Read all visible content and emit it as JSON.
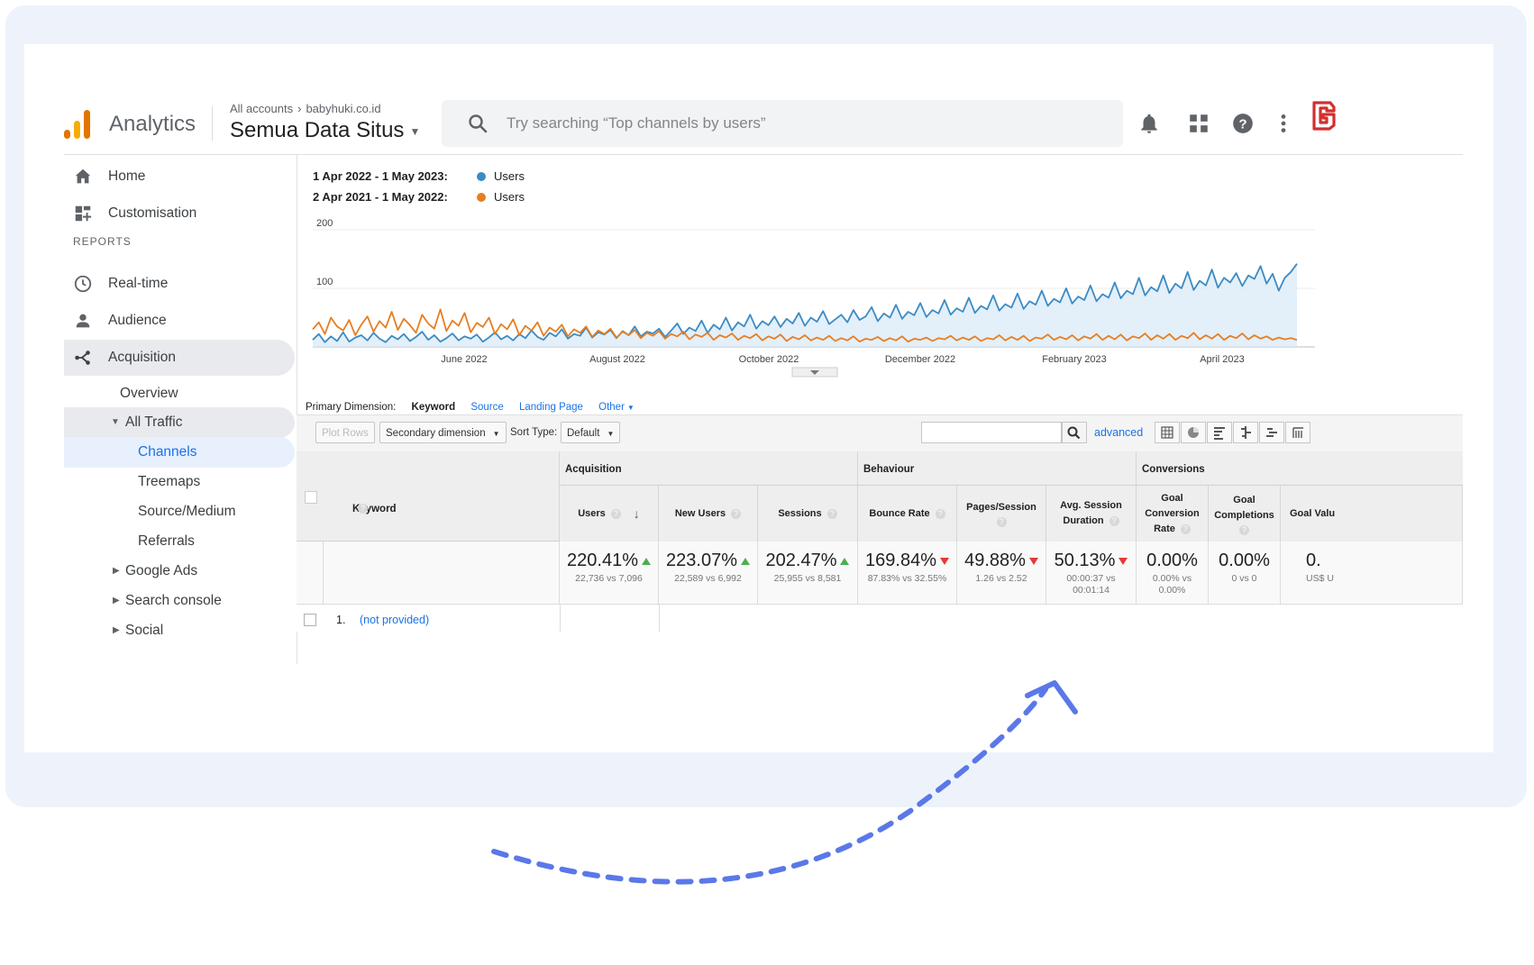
{
  "topbar": {
    "brand": "Analytics",
    "breadcrumb": [
      "All accounts",
      "babyhuki.co.id"
    ],
    "property": "Semua Data Situs",
    "search_placeholder": "Try searching “Top channels by users”"
  },
  "sidebar": {
    "items": [
      {
        "label": "Home",
        "icon": "home-icon"
      },
      {
        "label": "Customisation",
        "icon": "dashboard-icon"
      }
    ],
    "section": "REPORTS",
    "reports": [
      {
        "label": "Real-time",
        "icon": "clock-icon"
      },
      {
        "label": "Audience",
        "icon": "person-icon"
      },
      {
        "label": "Acquisition",
        "icon": "acquisition-icon"
      }
    ],
    "acquisition_sub": {
      "overview": "Overview",
      "all_traffic": "All Traffic",
      "channels": "Channels",
      "treemaps": "Treemaps",
      "source_medium": "Source/Medium",
      "referrals": "Referrals",
      "google_ads": "Google Ads",
      "search_console": "Search console",
      "social": "Social"
    }
  },
  "chart_data": {
    "type": "line",
    "legend": [
      {
        "range": "1 Apr 2022 - 1 May 2023:",
        "name": "Users",
        "color": "#3b8bc4"
      },
      {
        "range": "2 Apr 2021 - 1 May 2022:",
        "name": "Users",
        "color": "#e67e22"
      }
    ],
    "y_ticks": [
      "200",
      "100"
    ],
    "ylim": [
      0,
      200
    ],
    "x_ticks": [
      "June 2022",
      "August 2022",
      "October 2022",
      "December 2022",
      "February 2023",
      "April 2023"
    ],
    "series": [
      {
        "name": "Users",
        "color": "#3b8bc4",
        "values": [
          12,
          22,
          8,
          18,
          10,
          25,
          9,
          16,
          20,
          11,
          24,
          14,
          8,
          19,
          13,
          22,
          10,
          17,
          26,
          12,
          20,
          9,
          15,
          23,
          11,
          18,
          14,
          21,
          9,
          16,
          25,
          13,
          19,
          11,
          22,
          15,
          28,
          17,
          12,
          24,
          18,
          30,
          14,
          22,
          19,
          33,
          16,
          25,
          21,
          29,
          15,
          27,
          20,
          35,
          18,
          26,
          23,
          31,
          17,
          28,
          40,
          22,
          33,
          27,
          45,
          24,
          38,
          30,
          50,
          28,
          42,
          35,
          55,
          31,
          44,
          37,
          52,
          34,
          48,
          40,
          58,
          36,
          50,
          43,
          61,
          39,
          47,
          55,
          42,
          63,
          46,
          52,
          68,
          44,
          57,
          50,
          72,
          48,
          60,
          54,
          75,
          51,
          63,
          57,
          80,
          55,
          66,
          60,
          84,
          58,
          70,
          64,
          88,
          62,
          73,
          67,
          91,
          65,
          78,
          72,
          96,
          70,
          82,
          76,
          100,
          74,
          86,
          80,
          105,
          78,
          90,
          84,
          110,
          83,
          96,
          90,
          118,
          88,
          102,
          95,
          122,
          92,
          108,
          100,
          128,
          97,
          113,
          105,
          132,
          101,
          118,
          110,
          126,
          104,
          122,
          116,
          138,
          108,
          125,
          96,
          118,
          128,
          142
        ]
      },
      {
        "name": "Users",
        "color": "#e67e22",
        "values": [
          30,
          42,
          22,
          50,
          35,
          28,
          46,
          20,
          38,
          52,
          26,
          44,
          33,
          60,
          29,
          48,
          37,
          24,
          55,
          40,
          31,
          64,
          27,
          45,
          36,
          58,
          25,
          41,
          34,
          50,
          22,
          39,
          30,
          47,
          20,
          36,
          28,
          42,
          19,
          33,
          26,
          38,
          18,
          30,
          24,
          35,
          17,
          28,
          22,
          31,
          16,
          26,
          20,
          29,
          15,
          24,
          19,
          27,
          14,
          22,
          18,
          26,
          13,
          21,
          17,
          24,
          12,
          20,
          16,
          23,
          12,
          19,
          15,
          22,
          11,
          18,
          14,
          21,
          10,
          17,
          13,
          20,
          11,
          16,
          12,
          19,
          10,
          15,
          11,
          18,
          9,
          14,
          12,
          17,
          10,
          15,
          11,
          18,
          9,
          14,
          12,
          16,
          10,
          15,
          13,
          19,
          11,
          16,
          12,
          18,
          10,
          15,
          13,
          20,
          11,
          17,
          12,
          19,
          10,
          16,
          14,
          21,
          12,
          17,
          13,
          20,
          11,
          18,
          14,
          22,
          12,
          19,
          13,
          21,
          11,
          18,
          15,
          23,
          12,
          20,
          14,
          22,
          12,
          19,
          15,
          24,
          13,
          20,
          14,
          22,
          12,
          19,
          15,
          23,
          13,
          20,
          14,
          18,
          12,
          16,
          13,
          15,
          12
        ]
      }
    ]
  },
  "primary_dimension": {
    "label": "Primary Dimension:",
    "active": "Keyword",
    "options": [
      "Source",
      "Landing Page",
      "Other"
    ]
  },
  "toolbar": {
    "plot_rows": "Plot Rows",
    "secondary_dimension": "Secondary dimension",
    "sort_type_label": "Sort Type:",
    "sort_type_value": "Default",
    "advanced": "advanced"
  },
  "table": {
    "groups": [
      "Acquisition",
      "Behaviour",
      "Conversions"
    ],
    "keyword_header": "Keyword",
    "columns": [
      {
        "label": "Users",
        "pct": "220.41%",
        "cmp": "22,736 vs 7,096",
        "trend": "up"
      },
      {
        "label": "New Users",
        "pct": "223.07%",
        "cmp": "22,589 vs 6,992",
        "trend": "up"
      },
      {
        "label": "Sessions",
        "pct": "202.47%",
        "cmp": "25,955 vs 8,581",
        "trend": "up"
      },
      {
        "label": "Bounce Rate",
        "pct": "169.84%",
        "cmp": "87.83% vs 32.55%",
        "trend": "down"
      },
      {
        "label": "Pages/Session",
        "pct": "49.88%",
        "cmp": "1.26 vs 2.52",
        "trend": "down"
      },
      {
        "label": "Avg. Session Duration",
        "pct": "50.13%",
        "cmp": "00:00:37 vs 00:01:14",
        "trend": "down"
      },
      {
        "label": "Goal Conversion Rate",
        "pct": "0.00%",
        "cmp": "0.00% vs 0.00%",
        "trend": "none"
      },
      {
        "label": "Goal Completions",
        "pct": "0.00%",
        "cmp": "0 vs 0",
        "trend": "none"
      },
      {
        "label": "Goal Valu",
        "pct": "0.",
        "cmp": "US$ U",
        "trend": "none"
      }
    ],
    "rows": [
      {
        "index": "1.",
        "keyword": "(not provided)"
      }
    ]
  }
}
